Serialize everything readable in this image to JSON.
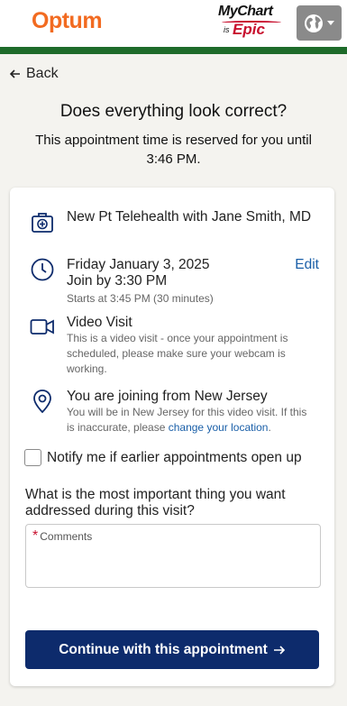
{
  "header": {
    "brand": "Optum",
    "mychart_logo": {
      "line1": "MyChart",
      "is": "is",
      "epic": "Epic"
    },
    "globe_menu": {
      "icon": "globe-icon",
      "caret": "caret-down-icon"
    },
    "colors": {
      "brand_orange": "#f26b21",
      "green_bar": "#1e6b2a",
      "epic_red": "#c8102e",
      "primary_blue": "#0d2b6c"
    }
  },
  "nav": {
    "back_label": "Back"
  },
  "page": {
    "title": "Does everything look correct?",
    "subtitle": "This appointment time is reserved for you until 3:46 PM."
  },
  "appointment": {
    "visit_type": {
      "icon": "medical-kit-icon",
      "text": "New Pt Telehealth with Jane Smith, MD"
    },
    "time": {
      "icon": "clock-icon",
      "date": "Friday January 3, 2025",
      "join_by": "Join by 3:30 PM",
      "starts": "Starts at 3:45 PM (30 minutes)",
      "edit_label": "Edit"
    },
    "video": {
      "icon": "video-camera-icon",
      "title": "Video Visit",
      "desc": "This is a video visit - once your appointment is scheduled, please make sure your webcam is working."
    },
    "location": {
      "icon": "location-pin-icon",
      "title": "You are joining from New Jersey",
      "desc_before": "You will be in New Jersey for this video visit. If this is inaccurate, please ",
      "link": "change your location",
      "desc_after": "."
    }
  },
  "notify": {
    "label": "Notify me if earlier appointments open up",
    "checked": false
  },
  "question": {
    "label": "What is the most important thing you want addressed during this visit?",
    "required_mark": "*",
    "placeholder": "Comments",
    "value": ""
  },
  "cta": {
    "label": "Continue with this appointment",
    "icon": "arrow-right-icon"
  }
}
